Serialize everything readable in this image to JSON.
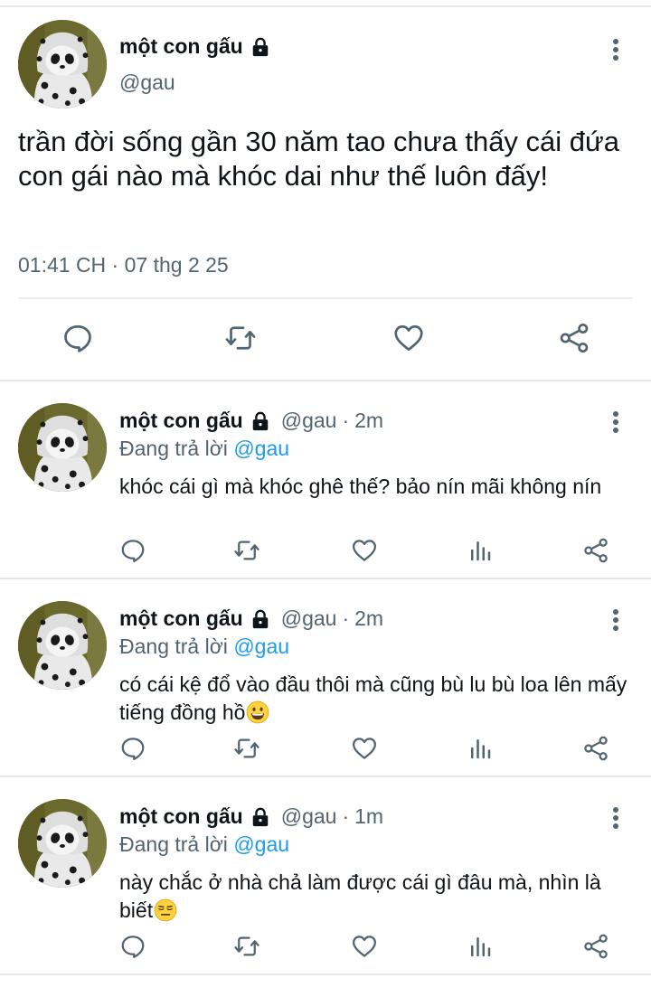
{
  "main_tweet": {
    "display_name": "một con gấu",
    "handle": "@gau",
    "text": "trần đời sống gần 30 năm tao chưa thấy cái đứa con gái nào mà khóc dai như thế luôn đấy!",
    "timestamp": "01:41 CH · 07 thg 2 25",
    "icons": [
      "lock-icon",
      "more-vertical-icon",
      "reply-icon",
      "retweet-icon",
      "like-icon",
      "share-icon"
    ]
  },
  "replies": [
    {
      "display_name": "một con gấu",
      "handle": "@gau",
      "separator": "·",
      "time": "2m",
      "replying_label": "Đang trả lời",
      "replying_to": "@gau",
      "text": "khóc cái gì mà khóc ghê thế? bảo nín mãi không nín",
      "emoji": ""
    },
    {
      "display_name": "một con gấu",
      "handle": "@gau",
      "separator": "·",
      "time": "2m",
      "replying_label": "Đang trả lời",
      "replying_to": "@gau",
      "text": "có cái kệ đổ vào đầu thôi mà cũng bù lu bù loa lên mấy tiếng đồng hồ",
      "emoji": "grinning-face"
    },
    {
      "display_name": "một con gấu",
      "handle": "@gau",
      "separator": "·",
      "time": "1m",
      "replying_label": "Đang trả lời",
      "replying_to": "@gau",
      "text": "này chắc ở nhà chả làm được cái gì đâu mà, nhìn là biết",
      "emoji": "expressionless-face"
    }
  ],
  "reply_action_icons": [
    "reply-icon",
    "retweet-icon",
    "like-icon",
    "views-icon",
    "share-icon"
  ],
  "colors": {
    "text": "#0f1419",
    "secondary": "#536471",
    "mention": "#1d9bf0",
    "divider": "#e6e8ea"
  }
}
